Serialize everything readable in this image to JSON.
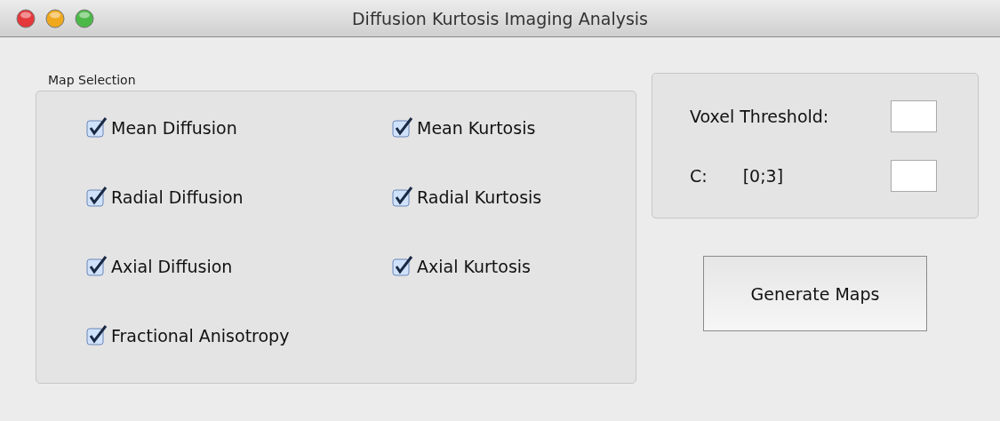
{
  "window": {
    "title": "Diffusion Kurtosis Imaging Analysis"
  },
  "map_selection": {
    "title": "Map Selection",
    "options": [
      {
        "label": "Mean Diffusion",
        "checked": true
      },
      {
        "label": "Mean Kurtosis",
        "checked": true
      },
      {
        "label": "Radial Diffusion",
        "checked": true
      },
      {
        "label": "Radial Kurtosis",
        "checked": true
      },
      {
        "label": "Axial Diffusion",
        "checked": true
      },
      {
        "label": "Axial Kurtosis",
        "checked": true
      },
      {
        "label": "Fractional Anisotropy",
        "checked": true
      }
    ]
  },
  "parameters": [
    {
      "label": "Voxel Threshold:"
    },
    {
      "label": "C:",
      "range": "[0;3]"
    }
  ],
  "button": "Generate Maps"
}
